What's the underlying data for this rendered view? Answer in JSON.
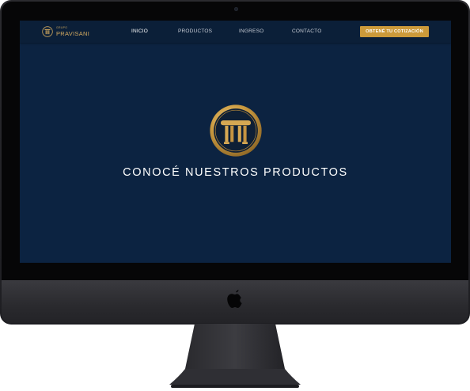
{
  "navbar": {
    "brand_group": "GRUPO",
    "brand_name": "PRAVISANI",
    "links": [
      {
        "label": "INICIO",
        "active": true
      },
      {
        "label": "PRODUCTOS",
        "active": false
      },
      {
        "label": "INGRESO",
        "active": false
      },
      {
        "label": "CONTACTO",
        "active": false
      }
    ],
    "cta_label": "OBTENÉ TU COTIZACIÓN"
  },
  "hero": {
    "emblem_icon": "pillar-emblem-icon",
    "title": "CONOCÉ NUESTROS PRODUCTOS"
  },
  "device": {
    "logo_icon": "apple-logo-icon"
  },
  "colors": {
    "background": "#0c2341",
    "navbar": "#0b1f38",
    "accent_gold": "#cc9a3a",
    "text": "#ffffff"
  }
}
